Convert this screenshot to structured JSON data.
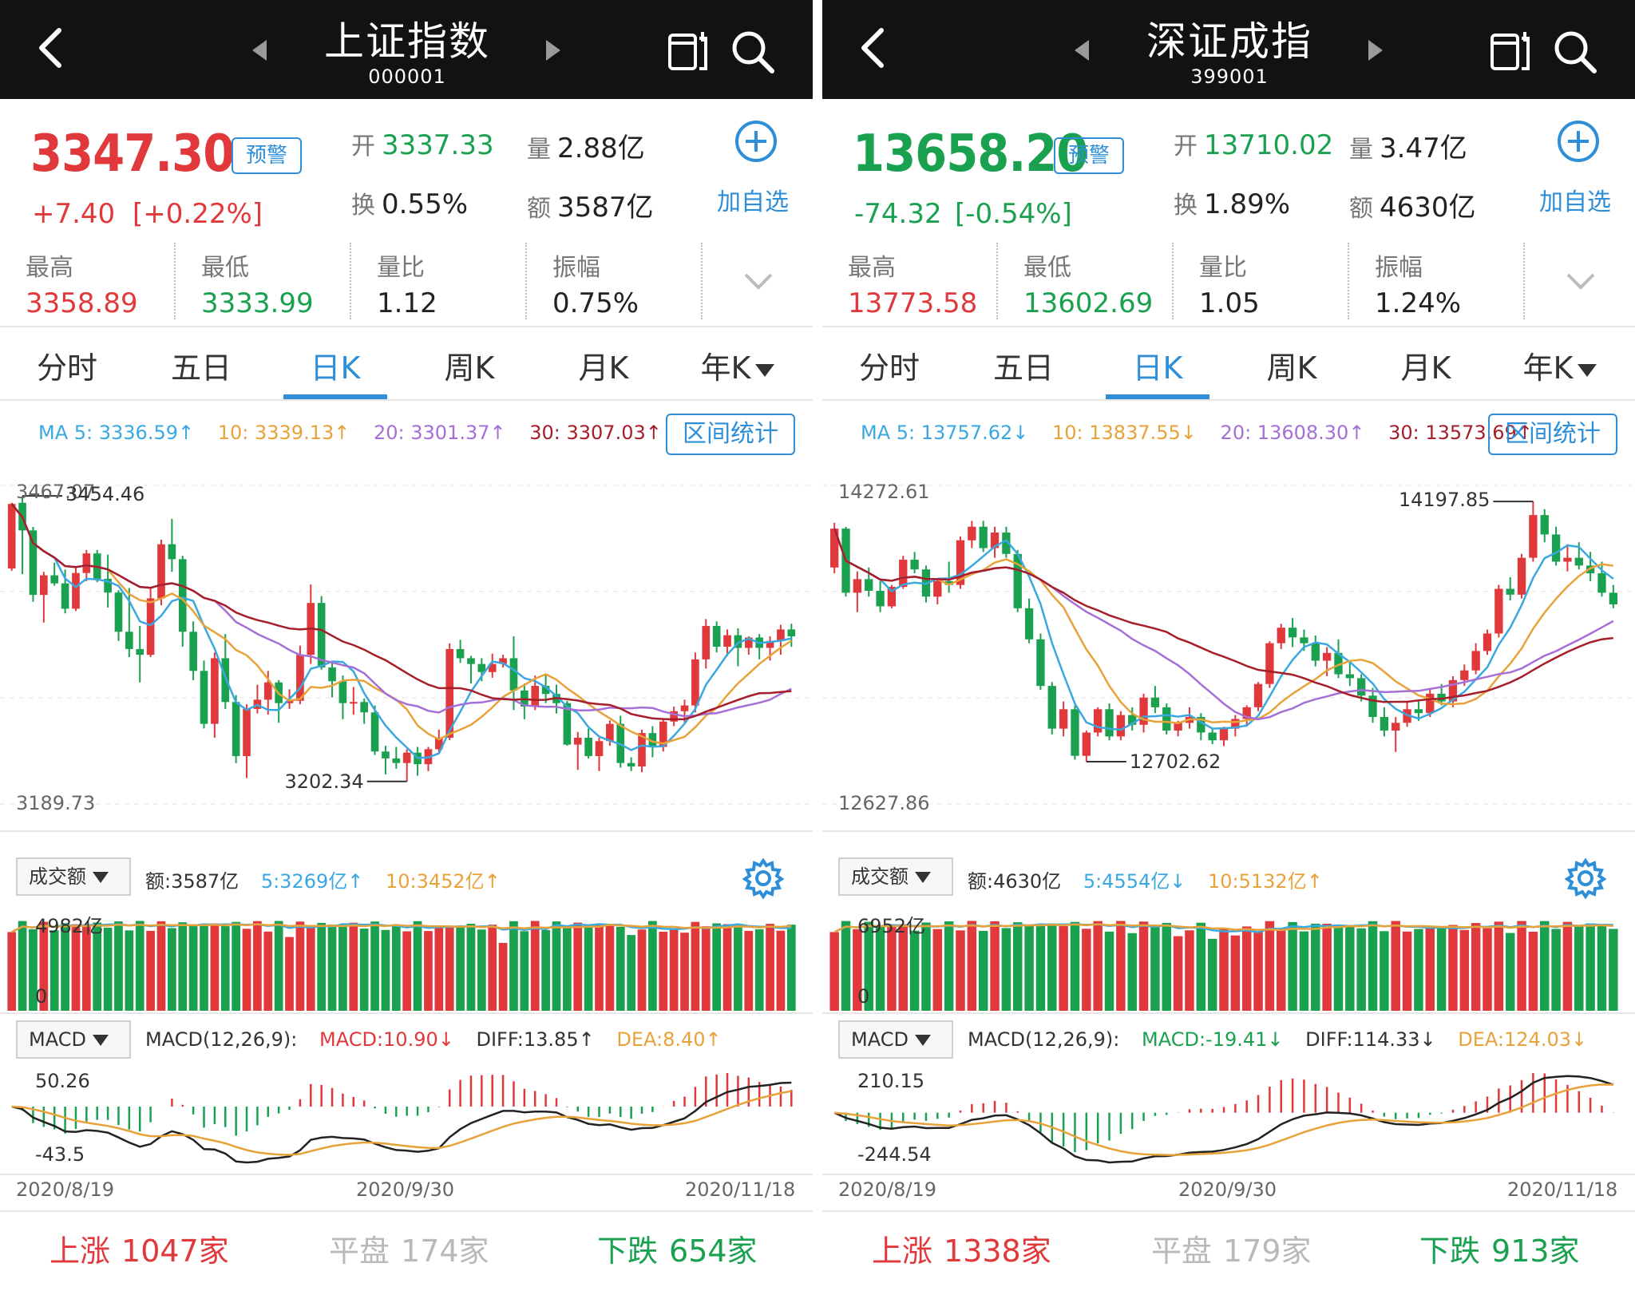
{
  "panels": [
    {
      "id": "sh",
      "title": "上证指数",
      "code": "000001",
      "price": "3347.30",
      "change": "+7.40",
      "change_pct": "[+0.22%]",
      "direction": "up",
      "alert_label": "预警",
      "open": {
        "label": "开",
        "value": "3337.33"
      },
      "volume": {
        "label": "量",
        "value": "2.88亿"
      },
      "turnover_rate": {
        "label": "换",
        "value": "0.55%"
      },
      "amount": {
        "label": "额",
        "value": "3587亿"
      },
      "add_watch_label": "加自选",
      "stats": [
        {
          "label": "最高",
          "value": "3358.89",
          "tone": "up"
        },
        {
          "label": "最低",
          "value": "3333.99",
          "tone": "down"
        },
        {
          "label": "量比",
          "value": "1.12",
          "tone": "flat"
        },
        {
          "label": "振幅",
          "value": "0.75%",
          "tone": "flat"
        }
      ],
      "tabs": [
        "分时",
        "五日",
        "日K",
        "周K",
        "月K",
        "年K"
      ],
      "active_tab": 2,
      "ma": {
        "ma5": "MA 5: 3336.59↑",
        "ma10": "10: 3339.13↑",
        "ma20": "20: 3301.37↑",
        "ma30": "30: 3307.03↑"
      },
      "range_btn": "区间统计",
      "kline_labels": {
        "top": "3467.07",
        "high_mark": "3454.46",
        "bottom": "3189.73",
        "low_mark": "3202.34"
      },
      "vol_selector": "成交额",
      "vol_info": {
        "amount": "额:3587亿",
        "ma5": "5:3269亿↑",
        "ma10": "10:3452亿↑"
      },
      "vol_labels": {
        "top": "4982亿",
        "bottom": "0"
      },
      "macd_selector": "MACD",
      "macd_info": {
        "params": "MACD(12,26,9):",
        "macd": "MACD:10.90↓",
        "diff": "DIFF:13.85↑",
        "dea": "DEA:8.40↑"
      },
      "macd_tone": "up",
      "macd_labels": {
        "top": "50.26",
        "bottom": "-43.5"
      },
      "dates": [
        "2020/8/19",
        "2020/9/30",
        "2020/11/18"
      ],
      "breadth": {
        "up_label": "上涨",
        "up_count": "1047家",
        "flat_label": "平盘",
        "flat_count": "174家",
        "down_label": "下跌",
        "down_count": "654家"
      },
      "candles": [
        [
          3395,
          3452,
          3393,
          3451
        ],
        [
          3452,
          3458,
          3390,
          3428
        ],
        [
          3428,
          3431,
          3366,
          3372
        ],
        [
          3372,
          3392,
          3348,
          3389
        ],
        [
          3389,
          3400,
          3380,
          3382
        ],
        [
          3382,
          3394,
          3356,
          3360
        ],
        [
          3360,
          3396,
          3358,
          3391
        ],
        [
          3391,
          3411,
          3384,
          3408
        ],
        [
          3408,
          3411,
          3383,
          3386
        ],
        [
          3386,
          3407,
          3361,
          3374
        ],
        [
          3374,
          3376,
          3332,
          3340
        ],
        [
          3340,
          3378,
          3318,
          3325
        ],
        [
          3325,
          3345,
          3296,
          3320
        ],
        [
          3320,
          3378,
          3318,
          3369
        ],
        [
          3369,
          3420,
          3363,
          3416
        ],
        [
          3416,
          3438,
          3392,
          3403
        ],
        [
          3403,
          3406,
          3327,
          3340
        ],
        [
          3340,
          3349,
          3298,
          3306
        ],
        [
          3306,
          3315,
          3256,
          3260
        ],
        [
          3260,
          3322,
          3248,
          3317
        ],
        [
          3317,
          3338,
          3273,
          3279
        ],
        [
          3279,
          3285,
          3226,
          3232
        ],
        [
          3232,
          3277,
          3213,
          3273
        ],
        [
          3273,
          3294,
          3269,
          3281
        ],
        [
          3281,
          3306,
          3268,
          3296
        ],
        [
          3296,
          3298,
          3261,
          3278
        ],
        [
          3278,
          3290,
          3273,
          3280
        ],
        [
          3280,
          3328,
          3277,
          3320
        ],
        [
          3320,
          3381,
          3312,
          3365
        ],
        [
          3365,
          3371,
          3307,
          3309
        ],
        [
          3309,
          3314,
          3283,
          3297
        ],
        [
          3297,
          3302,
          3264,
          3278
        ],
        [
          3278,
          3292,
          3268,
          3279
        ],
        [
          3279,
          3282,
          3260,
          3270
        ],
        [
          3270,
          3276,
          3233,
          3236
        ],
        [
          3236,
          3241,
          3216,
          3230
        ],
        [
          3230,
          3240,
          3221,
          3226
        ],
        [
          3226,
          3238,
          3210,
          3235
        ],
        [
          3235,
          3240,
          3215,
          3225
        ],
        [
          3225,
          3240,
          3219,
          3238
        ],
        [
          3238,
          3255,
          3235,
          3248
        ],
        [
          3248,
          3330,
          3246,
          3325
        ],
        [
          3325,
          3333,
          3313,
          3317
        ],
        [
          3317,
          3319,
          3295,
          3312
        ],
        [
          3312,
          3317,
          3297,
          3305
        ],
        [
          3305,
          3321,
          3300,
          3312
        ],
        [
          3312,
          3320,
          3309,
          3317
        ],
        [
          3317,
          3336,
          3272,
          3289
        ],
        [
          3289,
          3295,
          3264,
          3275
        ],
        [
          3275,
          3302,
          3272,
          3293
        ],
        [
          3293,
          3303,
          3278,
          3286
        ],
        [
          3286,
          3294,
          3269,
          3278
        ],
        [
          3278,
          3280,
          3241,
          3242
        ],
        [
          3242,
          3253,
          3220,
          3248
        ],
        [
          3248,
          3256,
          3230,
          3232
        ],
        [
          3232,
          3248,
          3219,
          3245
        ],
        [
          3245,
          3263,
          3241,
          3260
        ],
        [
          3260,
          3267,
          3222,
          3226
        ],
        [
          3226,
          3231,
          3219,
          3223
        ],
        [
          3223,
          3255,
          3218,
          3252
        ],
        [
          3252,
          3258,
          3231,
          3240
        ],
        [
          3240,
          3265,
          3236,
          3262
        ],
        [
          3262,
          3275,
          3258,
          3271
        ],
        [
          3271,
          3281,
          3261,
          3276
        ],
        [
          3276,
          3322,
          3270,
          3316
        ],
        [
          3316,
          3351,
          3308,
          3345
        ],
        [
          3345,
          3349,
          3322,
          3327
        ],
        [
          3327,
          3342,
          3319,
          3337
        ],
        [
          3337,
          3343,
          3310,
          3326
        ],
        [
          3326,
          3336,
          3320,
          3335
        ],
        [
          3335,
          3338,
          3316,
          3326
        ],
        [
          3326,
          3336,
          3315,
          3332
        ],
        [
          3332,
          3346,
          3320,
          3342
        ],
        [
          3342,
          3347,
          3327,
          3336
        ]
      ]
    },
    {
      "id": "sz",
      "title": "深证成指",
      "code": "399001",
      "price": "13658.20",
      "change": "-74.32",
      "change_pct": "[-0.54%]",
      "direction": "down",
      "alert_label": "预警",
      "open": {
        "label": "开",
        "value": "13710.02"
      },
      "volume": {
        "label": "量",
        "value": "3.47亿"
      },
      "turnover_rate": {
        "label": "换",
        "value": "1.89%"
      },
      "amount": {
        "label": "额",
        "value": "4630亿"
      },
      "add_watch_label": "加自选",
      "stats": [
        {
          "label": "最高",
          "value": "13773.58",
          "tone": "up"
        },
        {
          "label": "最低",
          "value": "13602.69",
          "tone": "down"
        },
        {
          "label": "量比",
          "value": "1.05",
          "tone": "flat"
        },
        {
          "label": "振幅",
          "value": "1.24%",
          "tone": "flat"
        }
      ],
      "tabs": [
        "分时",
        "五日",
        "日K",
        "周K",
        "月K",
        "年K"
      ],
      "active_tab": 2,
      "ma": {
        "ma5": "MA 5: 13757.62↓",
        "ma10": "10: 13837.55↓",
        "ma20": "20: 13608.30↑",
        "ma30": "30: 13573.69↑"
      },
      "range_btn": "区间统计",
      "kline_labels": {
        "top": "14272.61",
        "high_mark": "14197.85",
        "bottom": "12627.86",
        "low_mark": "12702.62"
      },
      "vol_selector": "成交额",
      "vol_info": {
        "amount": "额:4630亿",
        "ma5": "5:4554亿↓",
        "ma10": "10:5132亿↑"
      },
      "vol_labels": {
        "top": "6952亿",
        "bottom": "0"
      },
      "macd_selector": "MACD",
      "macd_info": {
        "params": "MACD(12,26,9):",
        "macd": "MACD:-19.41↓",
        "diff": "DIFF:114.33↓",
        "dea": "DEA:124.03↓"
      },
      "macd_tone": "down",
      "macd_labels": {
        "top": "210.15",
        "bottom": "-244.54"
      },
      "dates": [
        "2020/8/19",
        "2020/9/30",
        "2020/11/18"
      ],
      "breadth": {
        "up_label": "上涨",
        "up_count": "1338家",
        "flat_label": "平盘",
        "flat_count": "179家",
        "down_label": "下跌",
        "down_count": "913家"
      },
      "candles": [
        [
          13850,
          14080,
          13820,
          14050
        ],
        [
          14050,
          14060,
          13700,
          13720
        ],
        [
          13720,
          13830,
          13620,
          13790
        ],
        [
          13790,
          13850,
          13700,
          13730
        ],
        [
          13730,
          13780,
          13620,
          13650
        ],
        [
          13650,
          13760,
          13640,
          13750
        ],
        [
          13750,
          13910,
          13740,
          13890
        ],
        [
          13890,
          13930,
          13820,
          13840
        ],
        [
          13840,
          13860,
          13670,
          13700
        ],
        [
          13700,
          13790,
          13660,
          13780
        ],
        [
          13780,
          13880,
          13720,
          13760
        ],
        [
          13760,
          14010,
          13740,
          13990
        ],
        [
          13990,
          14090,
          13950,
          14060
        ],
        [
          14060,
          14090,
          13930,
          13950
        ],
        [
          13950,
          14060,
          13900,
          14030
        ],
        [
          14030,
          14060,
          13900,
          13920
        ],
        [
          13920,
          13940,
          13620,
          13640
        ],
        [
          13640,
          13690,
          13460,
          13480
        ],
        [
          13480,
          13510,
          13220,
          13240
        ],
        [
          13240,
          13260,
          12990,
          13020
        ],
        [
          13020,
          13160,
          12980,
          13120
        ],
        [
          13120,
          13140,
          12860,
          12880
        ],
        [
          12880,
          13010,
          12850,
          13000
        ],
        [
          13000,
          13130,
          12980,
          13120
        ],
        [
          13120,
          13150,
          12960,
          12980
        ],
        [
          12980,
          13110,
          12960,
          13090
        ],
        [
          13090,
          13130,
          13010,
          13040
        ],
        [
          13040,
          13200,
          13000,
          13180
        ],
        [
          13180,
          13240,
          13100,
          13130
        ],
        [
          13130,
          13150,
          12990,
          13010
        ],
        [
          13010,
          13060,
          12980,
          13050
        ],
        [
          13050,
          13130,
          13020,
          13080
        ],
        [
          13080,
          13100,
          12960,
          13000
        ],
        [
          13000,
          13020,
          12940,
          12960
        ],
        [
          12960,
          13030,
          12930,
          13020
        ],
        [
          13020,
          13090,
          12980,
          13070
        ],
        [
          13070,
          13140,
          13030,
          13130
        ],
        [
          13130,
          13260,
          13110,
          13250
        ],
        [
          13250,
          13470,
          13230,
          13460
        ],
        [
          13460,
          13560,
          13430,
          13540
        ],
        [
          13540,
          13590,
          13440,
          13490
        ],
        [
          13490,
          13530,
          13420,
          13460
        ],
        [
          13460,
          13500,
          13340,
          13370
        ],
        [
          13370,
          13440,
          13290,
          13410
        ],
        [
          13410,
          13480,
          13280,
          13300
        ],
        [
          13300,
          13360,
          13240,
          13280
        ],
        [
          13280,
          13300,
          13160,
          13190
        ],
        [
          13190,
          13230,
          13050,
          13080
        ],
        [
          13080,
          13130,
          12980,
          13010
        ],
        [
          13010,
          13080,
          12900,
          13050
        ],
        [
          13050,
          13160,
          13030,
          13120
        ],
        [
          13120,
          13160,
          13060,
          13100
        ],
        [
          13100,
          13220,
          13080,
          13200
        ],
        [
          13200,
          13250,
          13140,
          13160
        ],
        [
          13160,
          13290,
          13130,
          13270
        ],
        [
          13270,
          13350,
          13240,
          13320
        ],
        [
          13320,
          13460,
          13300,
          13420
        ],
        [
          13420,
          13530,
          13400,
          13510
        ],
        [
          13510,
          13760,
          13490,
          13740
        ],
        [
          13740,
          13800,
          13680,
          13710
        ],
        [
          13710,
          13920,
          13690,
          13900
        ],
        [
          13900,
          14190,
          13880,
          14120
        ],
        [
          14120,
          14150,
          13980,
          14020
        ],
        [
          14020,
          14060,
          13860,
          13880
        ],
        [
          13880,
          13970,
          13830,
          13900
        ],
        [
          13900,
          13980,
          13840,
          13860
        ],
        [
          13860,
          13930,
          13780,
          13820
        ],
        [
          13820,
          13880,
          13700,
          13720
        ],
        [
          13720,
          13760,
          13640,
          13660
        ]
      ]
    }
  ]
}
